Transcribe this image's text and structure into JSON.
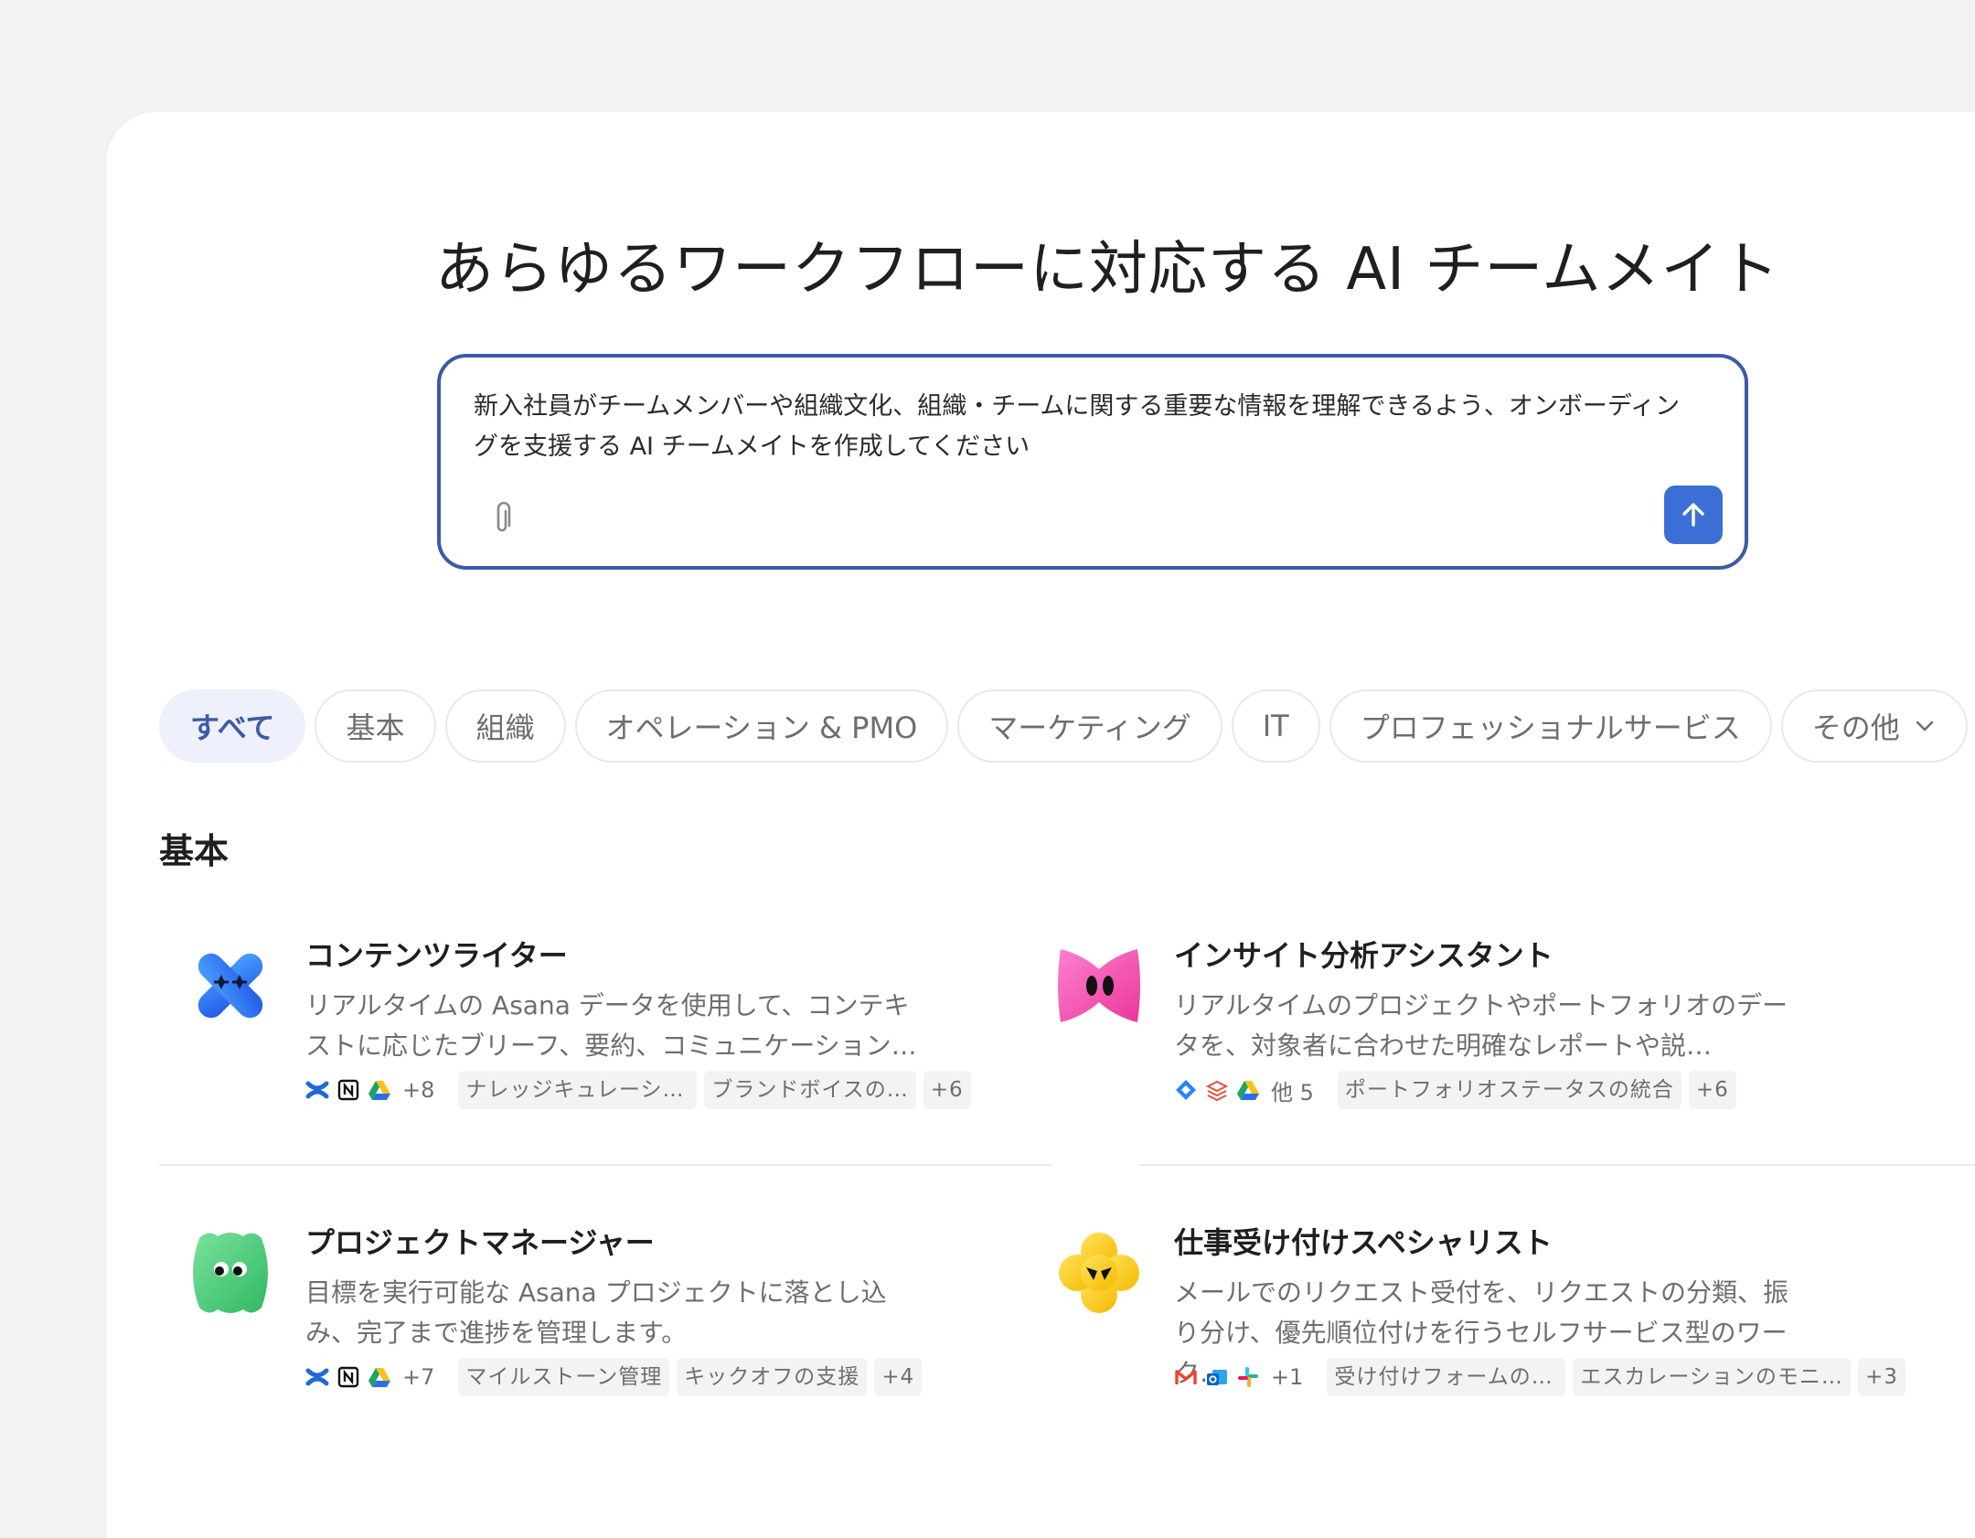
{
  "headline": "あらゆるワークフローに対応する AI チームメイト",
  "prompt": {
    "text": "新入社員がチームメンバーや組織文化、組織・チームに関する重要な情報を理解できるよう、オンボーディングを支援する AI チームメイトを作成してください",
    "attach_icon": "paperclip-icon",
    "send_icon": "arrow-up-icon"
  },
  "filters": [
    {
      "label": "すべて",
      "active": true
    },
    {
      "label": "基本"
    },
    {
      "label": "組織"
    },
    {
      "label": "オペレーション & PMO"
    },
    {
      "label": "マーケティング"
    },
    {
      "label": "IT"
    },
    {
      "label": "プロフェッショナルサービス"
    },
    {
      "label": "その他",
      "icon": "chevron-down-icon"
    }
  ],
  "section": {
    "title": "基本"
  },
  "cards": [
    {
      "title": "コンテンツライター",
      "description": "リアルタイムの Asana データを使用して、コンテキストに応じたブリーフ、要約、コミュニケーション…",
      "avatar": "blue-x-avatar",
      "apps": [
        "confluence-icon",
        "notion-icon",
        "google-drive-icon"
      ],
      "apps_more": "+8",
      "tags": [
        "ナレッジキュレーション",
        "ブランドボイスの…"
      ],
      "tags_more": "+6"
    },
    {
      "title": "インサイト分析アシスタント",
      "description": "リアルタイムのプロジェクトやポートフォリオのデータを、対象者に合わせた明確なレポートや説…",
      "avatar": "pink-bow-avatar",
      "apps": [
        "jira-icon",
        "stack-icon",
        "google-drive-icon"
      ],
      "apps_more": "他 5",
      "tags": [
        "ポートフォリオステータスの統合"
      ],
      "tags_more": "+6"
    },
    {
      "title": "プロジェクトマネージャー",
      "description": "目標を実行可能な Asana プロジェクトに落とし込み、完了まで進捗を管理します。",
      "avatar": "green-blob-avatar",
      "apps": [
        "confluence-icon",
        "notion-icon",
        "google-drive-icon"
      ],
      "apps_more": "+7",
      "tags": [
        "マイルストーン管理",
        "キックオフの支援"
      ],
      "tags_more": "+4"
    },
    {
      "title": "仕事受け付けスペシャリスト",
      "description": "メールでのリクエスト受付を、リクエストの分類、振り分け、優先順位付けを行うセルフサービス型のワーク…",
      "avatar": "yellow-flower-avatar",
      "apps": [
        "gmail-icon",
        "outlook-icon",
        "slack-icon"
      ],
      "apps_more": "+1",
      "tags": [
        "受け付けフォームの設計",
        "エスカレーションのモニ…"
      ],
      "tags_more": "+3"
    }
  ]
}
